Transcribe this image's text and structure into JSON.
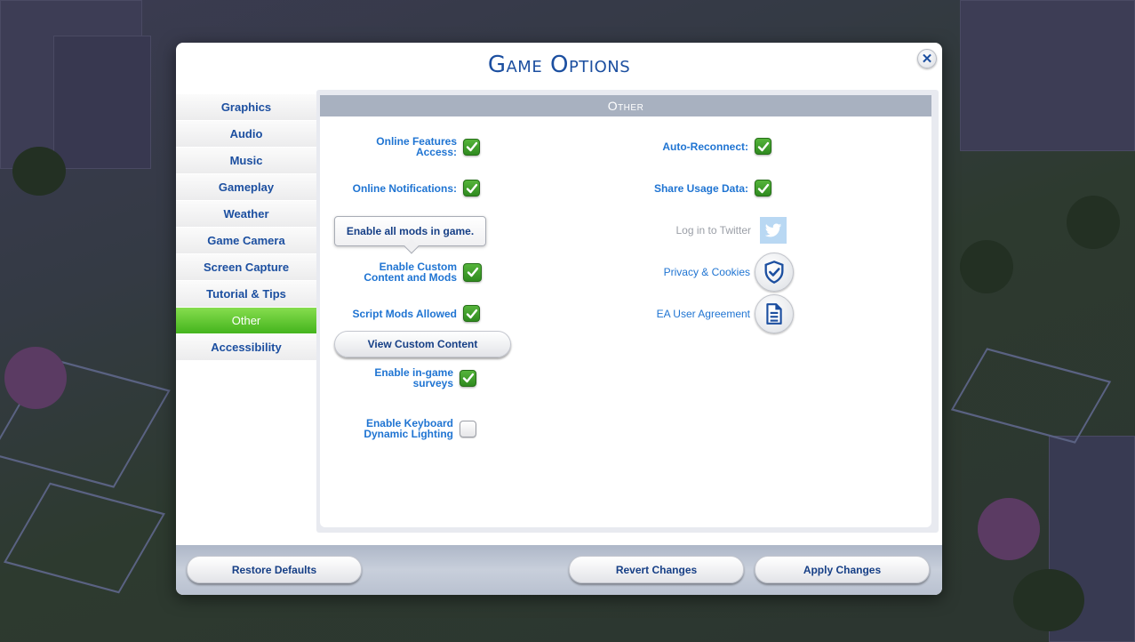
{
  "dialog": {
    "title": "Game Options",
    "close_icon": "close-icon"
  },
  "sidebar": {
    "items": [
      {
        "label": "Graphics",
        "active": false
      },
      {
        "label": "Audio",
        "active": false
      },
      {
        "label": "Music",
        "active": false
      },
      {
        "label": "Gameplay",
        "active": false
      },
      {
        "label": "Weather",
        "active": false
      },
      {
        "label": "Game Camera",
        "active": false
      },
      {
        "label": "Screen Capture",
        "active": false
      },
      {
        "label": "Tutorial & Tips",
        "active": false
      },
      {
        "label": "Other",
        "active": true
      },
      {
        "label": "Accessibility",
        "active": false
      }
    ]
  },
  "panel": {
    "header": "Other",
    "left_options": [
      {
        "label_line1": "Online Features",
        "label_line2": "Access:",
        "checked": true
      },
      {
        "label_line1": "Online Notifications:",
        "label_line2": "",
        "checked": true
      },
      {
        "label_line1": "Enable Custom",
        "label_line2": "Content and Mods",
        "checked": true
      },
      {
        "label_line1": "Script Mods Allowed",
        "label_line2": "",
        "checked": true
      },
      {
        "label_line1": "Enable in-game",
        "label_line2": "surveys",
        "checked": true
      },
      {
        "label_line1": "Enable Keyboard",
        "label_line2": "Dynamic Lighting",
        "checked": false
      }
    ],
    "tooltip": "Enable all mods in game.",
    "view_custom_content_label": "View Custom Content",
    "right_options": [
      {
        "label": "Auto-Reconnect:",
        "checked": true
      },
      {
        "label": "Share Usage Data:",
        "checked": true
      }
    ],
    "twitter": {
      "label": "Log in to Twitter",
      "icon": "twitter-icon"
    },
    "privacy": {
      "label": "Privacy & Cookies",
      "icon": "shield-check-icon"
    },
    "user_agreement": {
      "label": "EA User Agreement",
      "icon": "document-icon"
    }
  },
  "footer": {
    "restore_defaults": "Restore Defaults",
    "revert_changes": "Revert Changes",
    "apply_changes": "Apply Changes"
  },
  "colors": {
    "accent_blue": "#1c4fa0",
    "label_blue": "#1f74d2",
    "active_tab_green": "#5cc42e",
    "checkbox_green": "#3f9e2c",
    "header_gray": "#a8b1c0"
  }
}
